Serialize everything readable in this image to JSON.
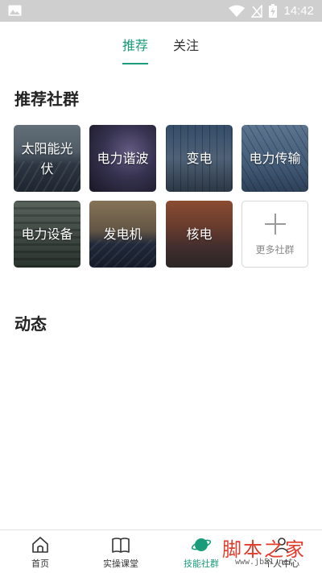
{
  "status_bar": {
    "time": "14:42"
  },
  "tabs": [
    {
      "label": "推荐",
      "active": true
    },
    {
      "label": "关注",
      "active": false
    }
  ],
  "sections": {
    "recommend_title": "推荐社群",
    "feed_title": "动态"
  },
  "communities": [
    {
      "label": "太阳能光伏"
    },
    {
      "label": "电力谐波"
    },
    {
      "label": "变电"
    },
    {
      "label": "电力传输"
    },
    {
      "label": "电力设备"
    },
    {
      "label": "发电机"
    },
    {
      "label": "核电"
    }
  ],
  "more_button": {
    "label": "更多社群",
    "icon": "plus-icon"
  },
  "bottom_nav": [
    {
      "label": "首页",
      "icon": "home-icon",
      "active": false
    },
    {
      "label": "实操课堂",
      "icon": "book-icon",
      "active": false
    },
    {
      "label": "技能社群",
      "icon": "planet-icon",
      "active": true
    },
    {
      "label": "个人中心",
      "icon": "person-icon",
      "active": false
    }
  ],
  "watermark": {
    "text": "脚本之家",
    "url": "www.jb51.net"
  },
  "colors": {
    "accent": "#1a9c7b",
    "status_bar": "#cfcfcf"
  }
}
